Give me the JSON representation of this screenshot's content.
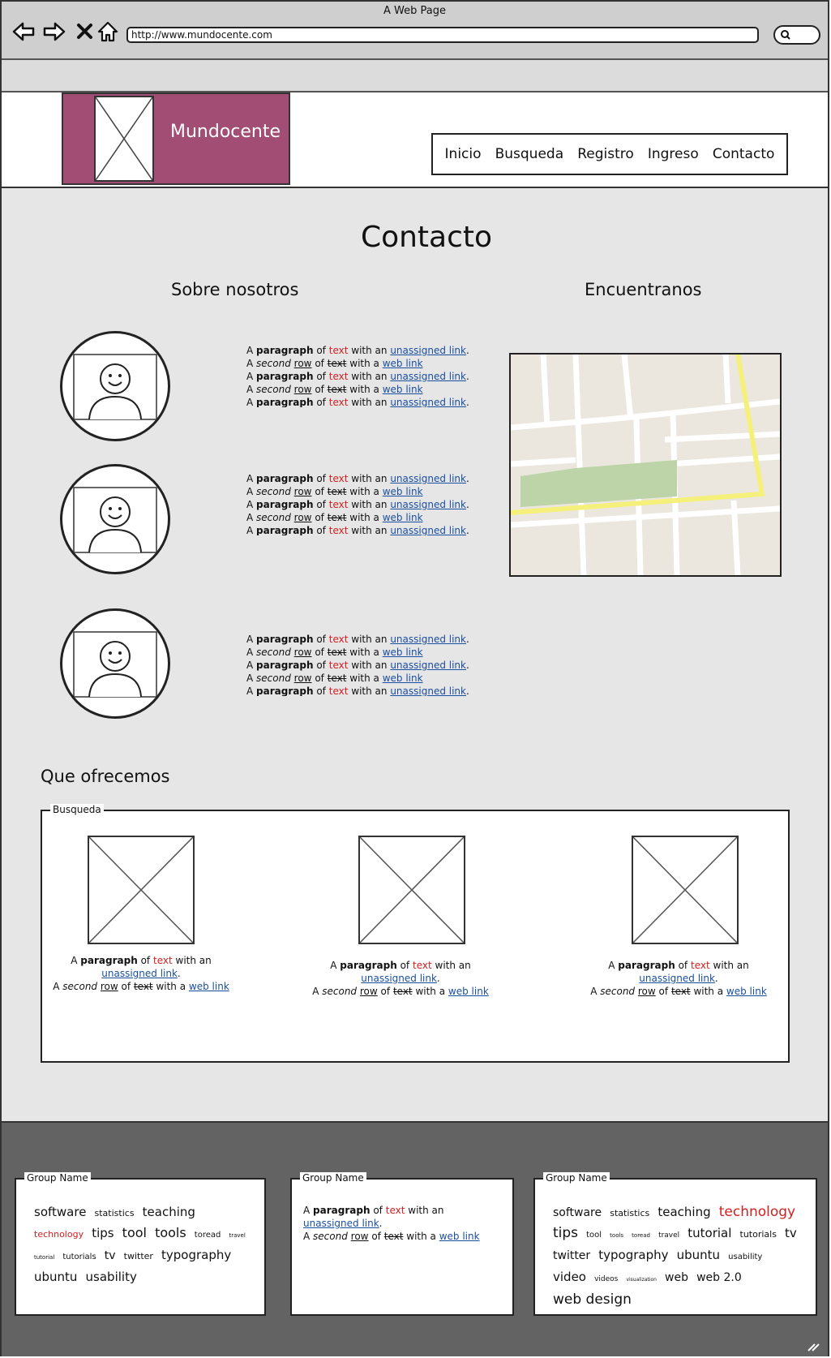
{
  "browser": {
    "title": "A Web Page",
    "url": "http://www.mundocente.com"
  },
  "header": {
    "brand": "Mundocente",
    "menu": [
      "Inicio",
      "Busqueda",
      "Registro",
      "Ingreso",
      "Contacto"
    ]
  },
  "page": {
    "title": "Contacto",
    "about_heading": "Sobre nosotros",
    "find_heading": "Encuentranos",
    "offer_heading": "Que ofrecemos"
  },
  "para": {
    "a": "A",
    "paragraph": "paragraph",
    "of": "of",
    "text": "text",
    "with_an": "with an",
    "unassigned_link": "unassigned link",
    "dot": ".",
    "second": "second",
    "row": "row",
    "with_a": "with a",
    "web_link": "web link"
  },
  "busqueda": {
    "label": "Busqueda",
    "cards": 3
  },
  "footer": {
    "group_label": "Group Name",
    "cloud1": [
      "software",
      "statistics",
      "teaching",
      "technology",
      "tips",
      "tool",
      "tools",
      "toread",
      "travel",
      "tutorial",
      "tutorials",
      "tv",
      "twitter",
      "typography",
      "ubuntu",
      "usability"
    ],
    "cloud2": [
      "software",
      "statistics",
      "teaching",
      "technology",
      "tips",
      "tool",
      "tools",
      "toread",
      "travel",
      "tutorial",
      "tutorials",
      "tv",
      "twitter",
      "typography",
      "ubuntu",
      "usability",
      "video",
      "videos",
      "visualization",
      "web",
      "web 2.0",
      "web design"
    ]
  },
  "colors": {
    "brand": "#a24d74",
    "link": "#1a4fa0",
    "red_text": "#d12020",
    "footer_bg": "#636363",
    "map_road_yellow": "#f5f07a",
    "map_park": "#bcd4a8"
  }
}
